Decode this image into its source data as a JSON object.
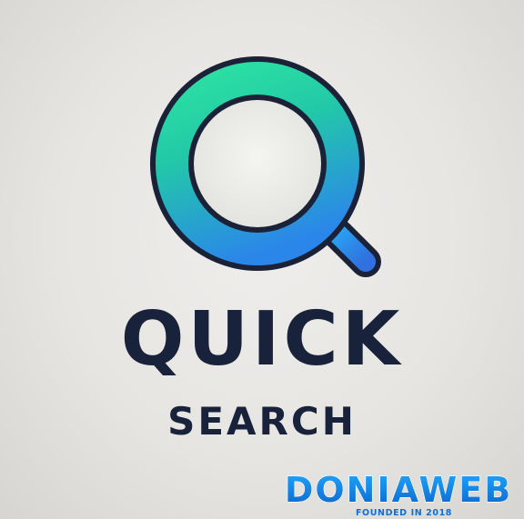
{
  "logo": {
    "title": "QUICK",
    "subtitle": "SEARCH",
    "icon": "magnifying-glass-with-lines-icon",
    "colors": {
      "ring_top": "#2ee5a0",
      "ring_bottom": "#2b8fe8",
      "text": "#18223a",
      "background": "#e8e7e4",
      "ring_outline": "#1b2238"
    }
  },
  "watermark": {
    "brand": "DONIAWEB",
    "tagline": "FOUNDED IN 2018",
    "colors": {
      "main": "#0d6fd3",
      "accent": "#1aa3ff"
    }
  }
}
